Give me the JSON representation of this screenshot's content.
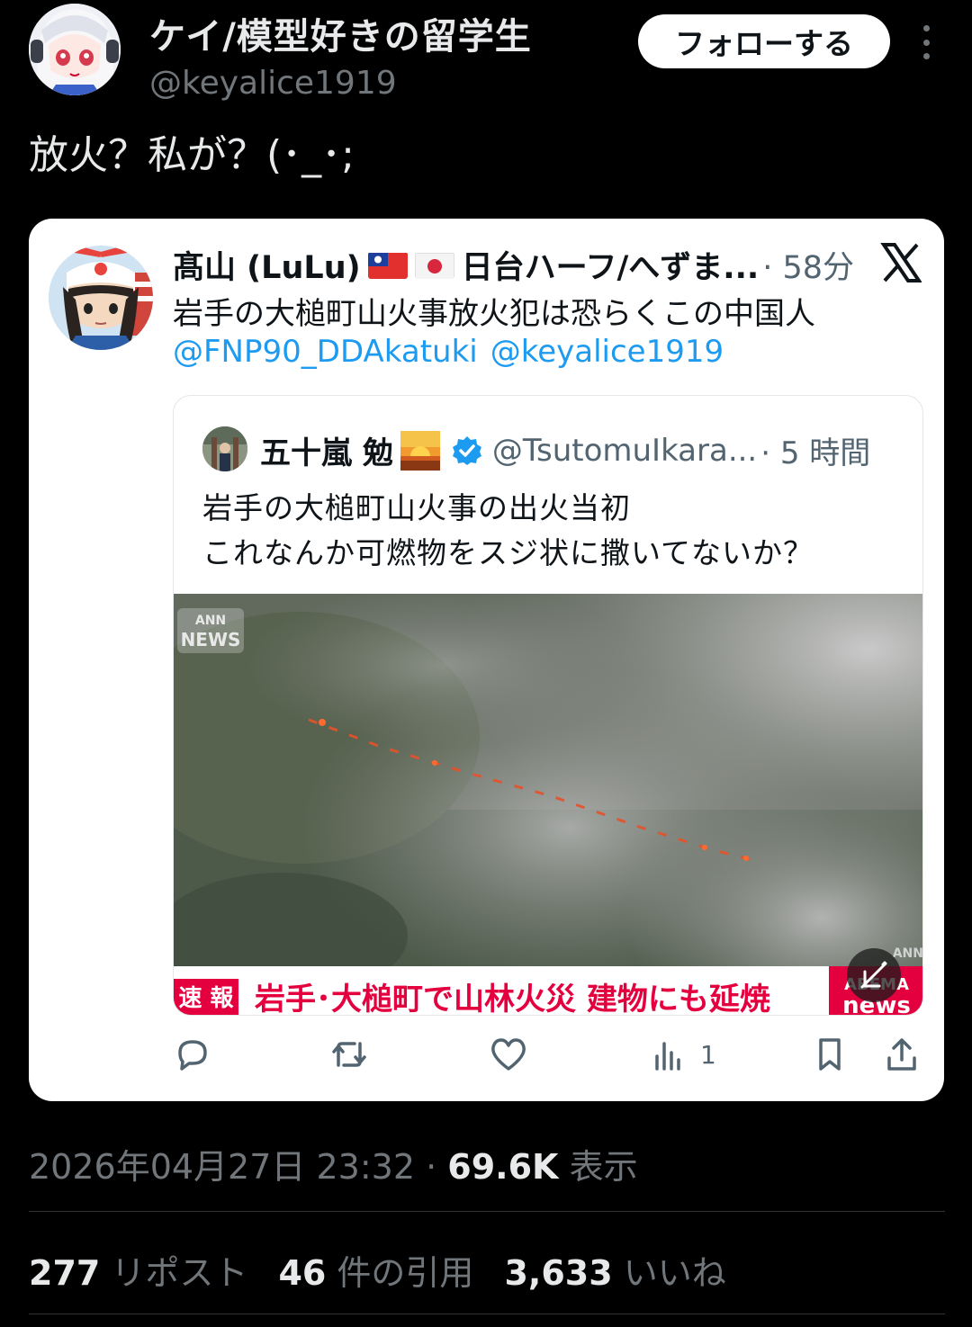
{
  "author": {
    "display_name": "ケイ/模型好きの留学生",
    "handle": "@keyalice1919",
    "follow_label": "フォローする"
  },
  "tweet": {
    "text": "放火？私が？(･_･;"
  },
  "quoted_tweet": {
    "display_name": "髙山 (LuLu)",
    "name_suffix": "日台ハーフ/へずま...",
    "time": "· 58分",
    "text": "岩手の大槌町山火事放火犯は恐らくこの中国人",
    "mentions": [
      "@FNP90_DDAkatuki",
      "@keyalice1919"
    ],
    "nested_quote": {
      "display_name": "五十嵐 勉",
      "handle": "@TsutomuIkara...",
      "time": "· 5 時間",
      "text_line1": "岩手の大槌町山火事の出火当初",
      "text_line2": "これなんか可燃物をスジ状に撒いてないか？",
      "media": {
        "watermark_top": "ANN",
        "watermark_bottom": "NEWS",
        "breaking_label": "速 報",
        "caption": "岩手･大槌町で山林火災 建物にも延焼",
        "corner_logo_top": "ANN",
        "corner_logo": "ABEMA",
        "corner_logo_bottom": "news"
      }
    },
    "actions": {
      "views_count": "1"
    }
  },
  "meta": {
    "timestamp": "2026年04月27日 23:32",
    "separator": " · ",
    "views": "69.6K",
    "views_label": "表示"
  },
  "stats": {
    "reposts_count": "277",
    "reposts_label": "リポスト",
    "quotes_count": "46",
    "quotes_label": "件の引用",
    "likes_count": "3,633",
    "likes_label": "いいね"
  },
  "colors": {
    "background": "#000000",
    "text_primary": "#e7e9ea",
    "text_secondary": "#71767b",
    "link": "#1d9bf0",
    "breaking_red": "#e4003f"
  }
}
